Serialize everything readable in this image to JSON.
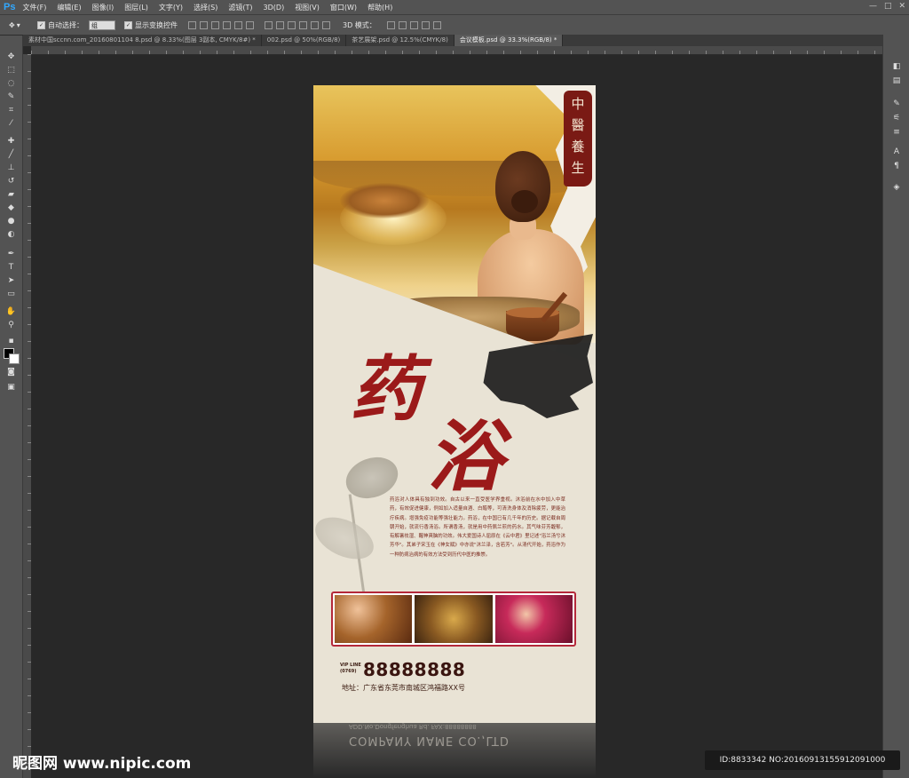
{
  "app": {
    "logo": "Ps"
  },
  "menu": [
    "文件(F)",
    "编辑(E)",
    "图像(I)",
    "图层(L)",
    "文字(Y)",
    "选择(S)",
    "滤镜(T)",
    "3D(D)",
    "视图(V)",
    "窗口(W)",
    "帮助(H)"
  ],
  "options": {
    "auto_select_label": "自动选择：",
    "auto_select_value": "组",
    "show_transform_label": "显示变换控件",
    "mode_3d_label": "3D 模式："
  },
  "tabs": [
    {
      "label": "素材中国sccnn.com_20160801104 8.psd @ 8.33%(图层 3副本, CMYK/8#) *",
      "active": false
    },
    {
      "label": "002.psd @ 50%(RGB/8)",
      "active": false
    },
    {
      "label": "茶艺展架.psd @ 12.5%(CMYK/8)",
      "active": false
    },
    {
      "label": "会议模板.psd @ 33.3%(RGB/8) *",
      "active": true
    }
  ],
  "document": {
    "seal_chars": [
      "中",
      "醫",
      "養",
      "生"
    ],
    "title_chars": [
      "药",
      "浴"
    ],
    "body_text": "药浴对人体具有独到功效。自古以来一直受医学界重视。沐浴前在水中加入中草药，有效促进健康，例如加入适量自酒、白醋等，可清洗身体及消除疲劳，更能治疗疾病。增强免疫功能等强壮能力。药浴，在中国已有几千年的历史。据记载自周朝开始，就流行香汤浴。所谓香汤，就是用中药佩兰煎的药水。其气味芬芳馥郁，有解暑祛湿、醒神爽脑的功效。伟大爱国诗人屈原在《云中君》里记述\"浴兰汤兮沐芳华\"。其弟子宋玉在《神女赋》中亦说\"沐兰泽，含若芳\"。从清代开始，药浴作为一种防病治病的有效方法受到历代中医的推崇。",
    "tel_label": "VIP LINE (0769)",
    "tel": "88888888",
    "address": "地址：广东省东莞市南城区鸿福路XX号",
    "reflection_line1": "COMPANY NAME CO.,LTD",
    "reflection_line2": "ADD.No.Dongfenghua Rd. FAX:88888888"
  },
  "watermark": "昵图网 www.nipic.com",
  "id_info": "ID:8833342 NO:20160913155912091000"
}
